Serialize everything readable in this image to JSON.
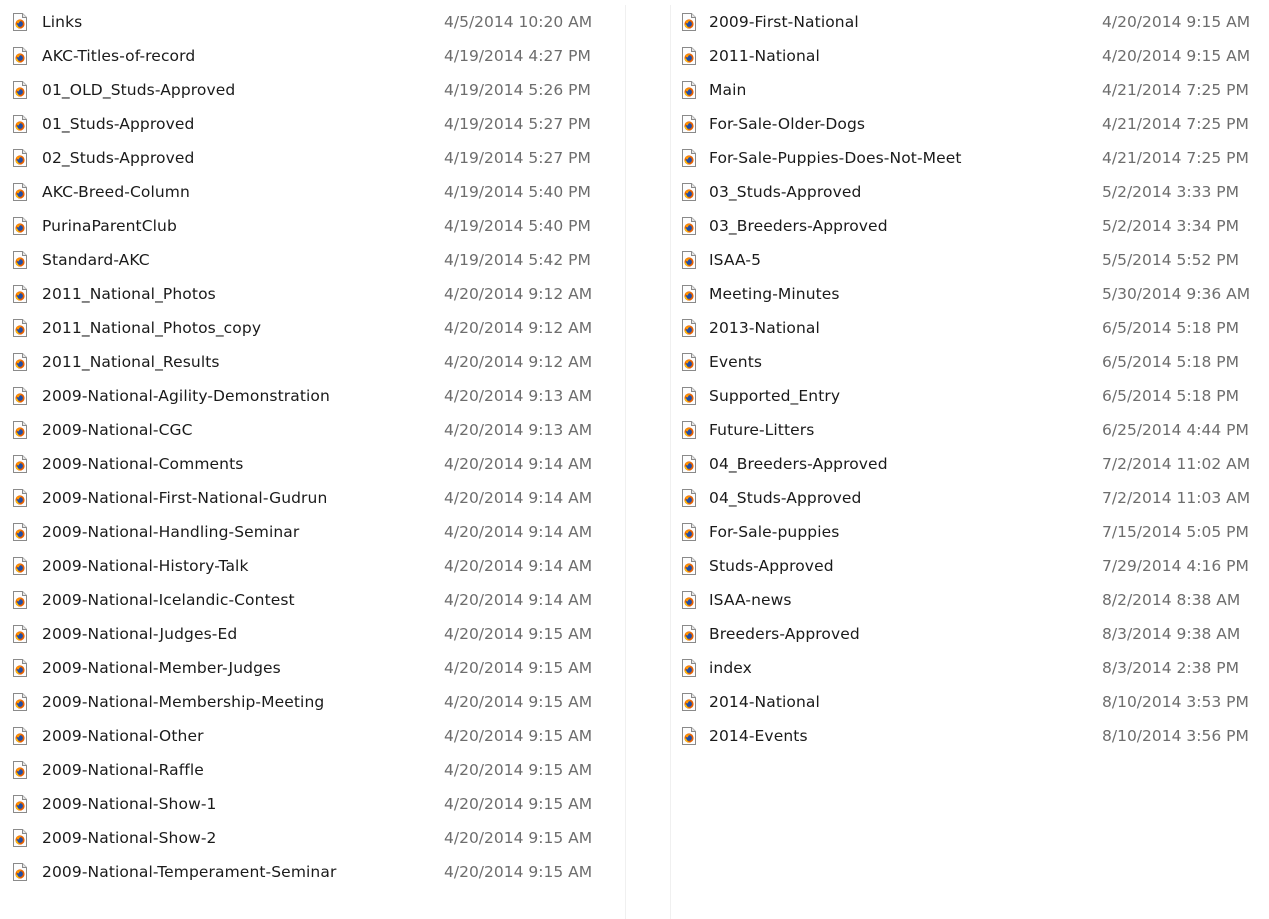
{
  "colors": {
    "background": "#ffffff",
    "name_text": "#1a1a1a",
    "date_text": "#6d6d6d"
  },
  "file_icon": "firefox-html-document-icon",
  "left_list": [
    {
      "name": "Links",
      "date": "4/5/2014 10:20 AM"
    },
    {
      "name": "AKC-Titles-of-record",
      "date": "4/19/2014 4:27 PM"
    },
    {
      "name": "01_OLD_Studs-Approved",
      "date": "4/19/2014 5:26 PM"
    },
    {
      "name": "01_Studs-Approved",
      "date": "4/19/2014 5:27 PM"
    },
    {
      "name": "02_Studs-Approved",
      "date": "4/19/2014 5:27 PM"
    },
    {
      "name": "AKC-Breed-Column",
      "date": "4/19/2014 5:40 PM"
    },
    {
      "name": "PurinaParentClub",
      "date": "4/19/2014 5:40 PM"
    },
    {
      "name": "Standard-AKC",
      "date": "4/19/2014 5:42 PM"
    },
    {
      "name": "2011_National_Photos",
      "date": "4/20/2014 9:12 AM"
    },
    {
      "name": "2011_National_Photos_copy",
      "date": "4/20/2014 9:12 AM"
    },
    {
      "name": "2011_National_Results",
      "date": "4/20/2014 9:12 AM"
    },
    {
      "name": "2009-National-Agility-Demonstration",
      "date": "4/20/2014 9:13 AM"
    },
    {
      "name": "2009-National-CGC",
      "date": "4/20/2014 9:13 AM"
    },
    {
      "name": "2009-National-Comments",
      "date": "4/20/2014 9:14 AM"
    },
    {
      "name": "2009-National-First-National-Gudrun",
      "date": "4/20/2014 9:14 AM"
    },
    {
      "name": "2009-National-Handling-Seminar",
      "date": "4/20/2014 9:14 AM"
    },
    {
      "name": "2009-National-History-Talk",
      "date": "4/20/2014 9:14 AM"
    },
    {
      "name": "2009-National-Icelandic-Contest",
      "date": "4/20/2014 9:14 AM"
    },
    {
      "name": "2009-National-Judges-Ed",
      "date": "4/20/2014 9:15 AM"
    },
    {
      "name": "2009-National-Member-Judges",
      "date": "4/20/2014 9:15 AM"
    },
    {
      "name": "2009-National-Membership-Meeting",
      "date": "4/20/2014 9:15 AM"
    },
    {
      "name": "2009-National-Other",
      "date": "4/20/2014 9:15 AM"
    },
    {
      "name": "2009-National-Raffle",
      "date": "4/20/2014 9:15 AM"
    },
    {
      "name": "2009-National-Show-1",
      "date": "4/20/2014 9:15 AM"
    },
    {
      "name": "2009-National-Show-2",
      "date": "4/20/2014 9:15 AM"
    },
    {
      "name": "2009-National-Temperament-Seminar",
      "date": "4/20/2014 9:15 AM"
    }
  ],
  "right_list": [
    {
      "name": "2009-First-National",
      "date": "4/20/2014 9:15 AM"
    },
    {
      "name": "2011-National",
      "date": "4/20/2014 9:15 AM"
    },
    {
      "name": "Main",
      "date": "4/21/2014 7:25 PM"
    },
    {
      "name": "For-Sale-Older-Dogs",
      "date": "4/21/2014 7:25 PM"
    },
    {
      "name": "For-Sale-Puppies-Does-Not-Meet",
      "date": "4/21/2014 7:25 PM"
    },
    {
      "name": "03_Studs-Approved",
      "date": "5/2/2014 3:33 PM"
    },
    {
      "name": "03_Breeders-Approved",
      "date": "5/2/2014 3:34 PM"
    },
    {
      "name": "ISAA-5",
      "date": "5/5/2014 5:52 PM"
    },
    {
      "name": "Meeting-Minutes",
      "date": "5/30/2014 9:36 AM"
    },
    {
      "name": "2013-National",
      "date": "6/5/2014 5:18 PM"
    },
    {
      "name": "Events",
      "date": "6/5/2014 5:18 PM"
    },
    {
      "name": "Supported_Entry",
      "date": "6/5/2014 5:18 PM"
    },
    {
      "name": "Future-Litters",
      "date": "6/25/2014 4:44 PM"
    },
    {
      "name": "04_Breeders-Approved",
      "date": "7/2/2014 11:02 AM"
    },
    {
      "name": "04_Studs-Approved",
      "date": "7/2/2014 11:03 AM"
    },
    {
      "name": "For-Sale-puppies",
      "date": "7/15/2014 5:05 PM"
    },
    {
      "name": "Studs-Approved",
      "date": "7/29/2014 4:16 PM"
    },
    {
      "name": "ISAA-news",
      "date": "8/2/2014 8:38 AM"
    },
    {
      "name": "Breeders-Approved",
      "date": "8/3/2014 9:38 AM"
    },
    {
      "name": "index",
      "date": "8/3/2014 2:38 PM"
    },
    {
      "name": "2014-National",
      "date": "8/10/2014 3:53 PM"
    },
    {
      "name": "2014-Events",
      "date": "8/10/2014 3:56 PM"
    }
  ]
}
